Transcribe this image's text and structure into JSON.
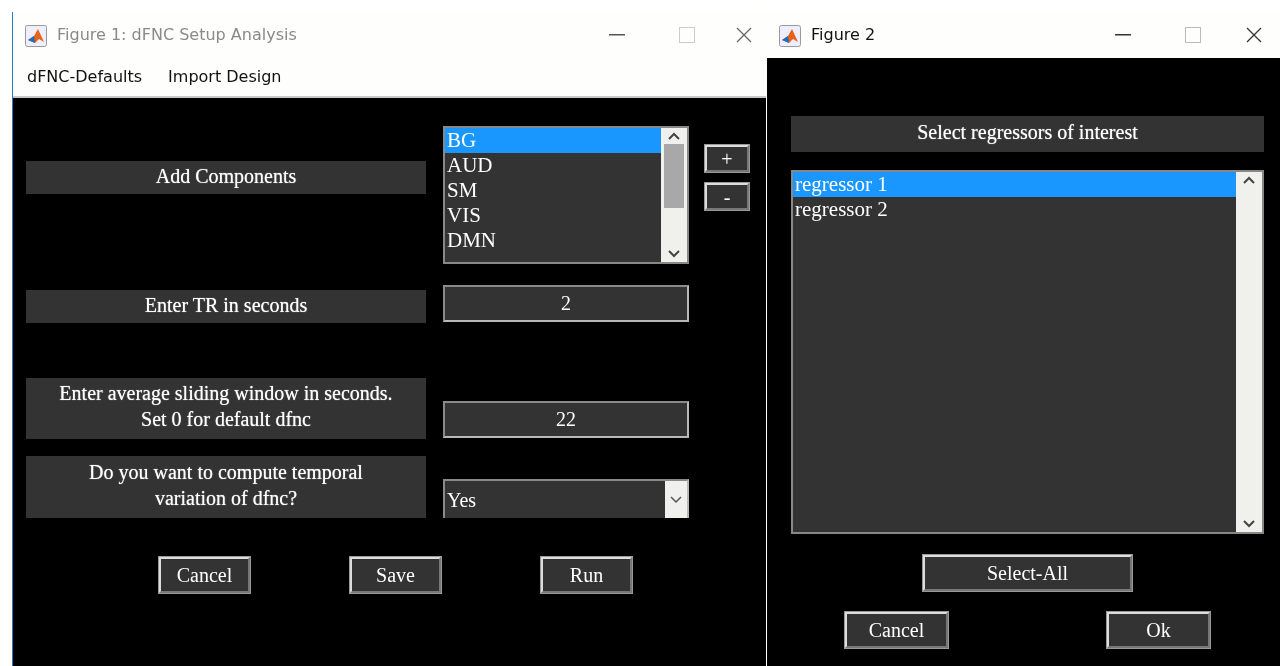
{
  "figure_1": {
    "title": "Figure 1: dFNC Setup Analysis",
    "active": false,
    "menu": [
      "dFNC-Defaults",
      "Import Design"
    ],
    "components": {
      "label": "Add Components",
      "items": [
        {
          "text": "BG",
          "selected": true
        },
        {
          "text": "AUD",
          "selected": false
        },
        {
          "text": "SM",
          "selected": false
        },
        {
          "text": "VIS",
          "selected": false
        },
        {
          "text": "DMN",
          "selected": false
        }
      ],
      "add_button": "+",
      "remove_button": "-"
    },
    "tr": {
      "label": "Enter TR in seconds",
      "value": "2"
    },
    "sliding_window": {
      "label": "Enter average sliding window in seconds.\nSet 0 for default dfnc",
      "value": "22"
    },
    "temporal_variation": {
      "label": "Do you want to compute temporal\nvariation of dfnc?",
      "value": "Yes"
    },
    "buttons": [
      "Cancel",
      "Save",
      "Run"
    ]
  },
  "figure_2": {
    "title": "Figure 2",
    "active": true,
    "heading": "Select regressors of interest",
    "items": [
      {
        "text": "regressor 1",
        "selected": true
      },
      {
        "text": "regressor 2",
        "selected": false
      }
    ],
    "select_all_button": "Select-All",
    "buttons": [
      "Cancel",
      "Ok"
    ]
  }
}
